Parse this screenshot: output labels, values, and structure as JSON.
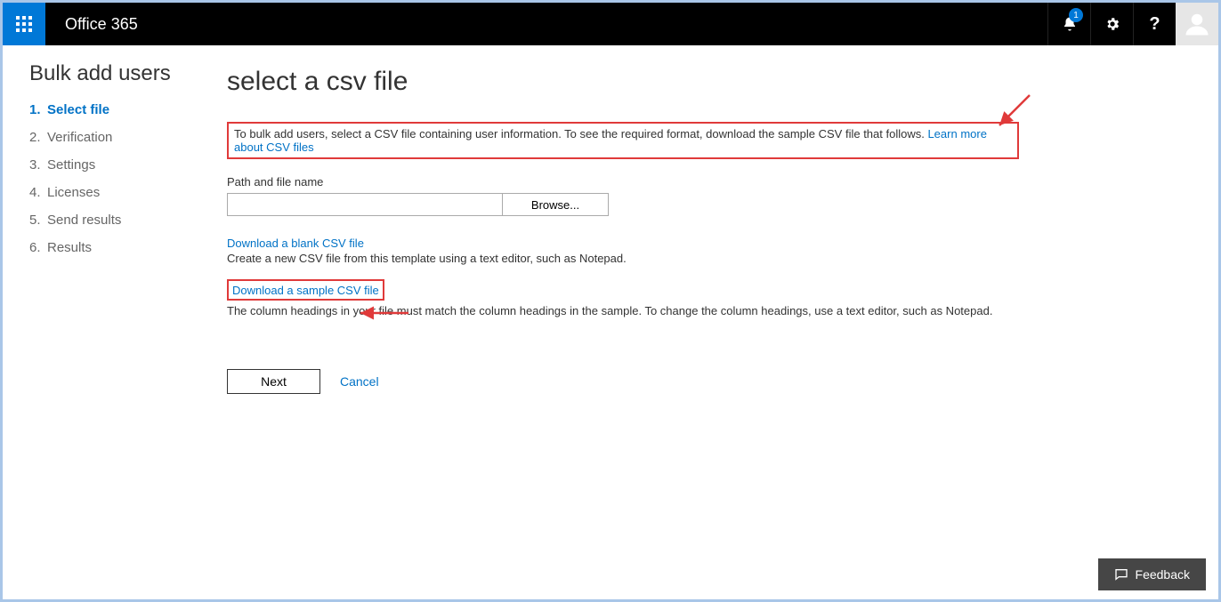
{
  "header": {
    "brand": "Office 365",
    "notification_count": "1"
  },
  "page": {
    "title": "Bulk add users"
  },
  "steps": [
    {
      "num": "1.",
      "label": "Select file",
      "active": true
    },
    {
      "num": "2.",
      "label": "Verification",
      "active": false
    },
    {
      "num": "3.",
      "label": "Settings",
      "active": false
    },
    {
      "num": "4.",
      "label": "Licenses",
      "active": false
    },
    {
      "num": "5.",
      "label": "Send results",
      "active": false
    },
    {
      "num": "6.",
      "label": "Results",
      "active": false
    }
  ],
  "main": {
    "heading": "select a csv file",
    "info_text": "To bulk add users, select a CSV file containing user information. To see the required format, download the sample CSV file that follows. ",
    "info_link": "Learn more about CSV files",
    "path_label": "Path and file name",
    "path_value": "",
    "browse_label": "Browse...",
    "blank_link": "Download a blank CSV file",
    "blank_desc": "Create a new CSV file from this template using a text editor, such as Notepad.",
    "sample_link": "Download a sample CSV file",
    "sample_desc": "The column headings in your file must match the column headings in the sample. To change the column headings, use a text editor, such as Notepad.",
    "next_label": "Next",
    "cancel_label": "Cancel"
  },
  "feedback": {
    "label": "Feedback"
  }
}
